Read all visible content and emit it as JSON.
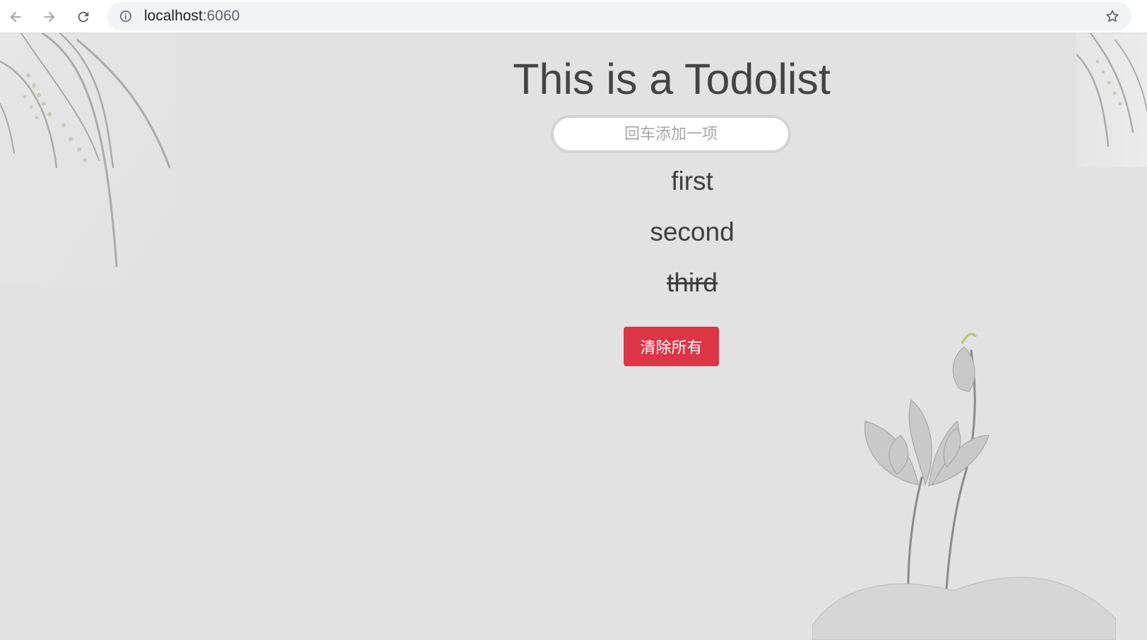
{
  "browser": {
    "url_host": "localhost",
    "url_port": ":6060",
    "icons": [
      "back-arrow-icon",
      "forward-arrow-icon",
      "reload-icon",
      "site-info-icon",
      "bookmark-star-icon"
    ]
  },
  "page": {
    "title": "This is a Todolist",
    "input": {
      "placeholder": "回车添加一项",
      "value": ""
    },
    "todos": [
      {
        "text": "first",
        "done": false
      },
      {
        "text": "second",
        "done": false
      },
      {
        "text": "third",
        "done": true
      }
    ],
    "clear_button_label": "清除所有",
    "colors": {
      "background": "#e2e2e2",
      "clear_button": "#dc3545",
      "text": "#444444"
    }
  }
}
